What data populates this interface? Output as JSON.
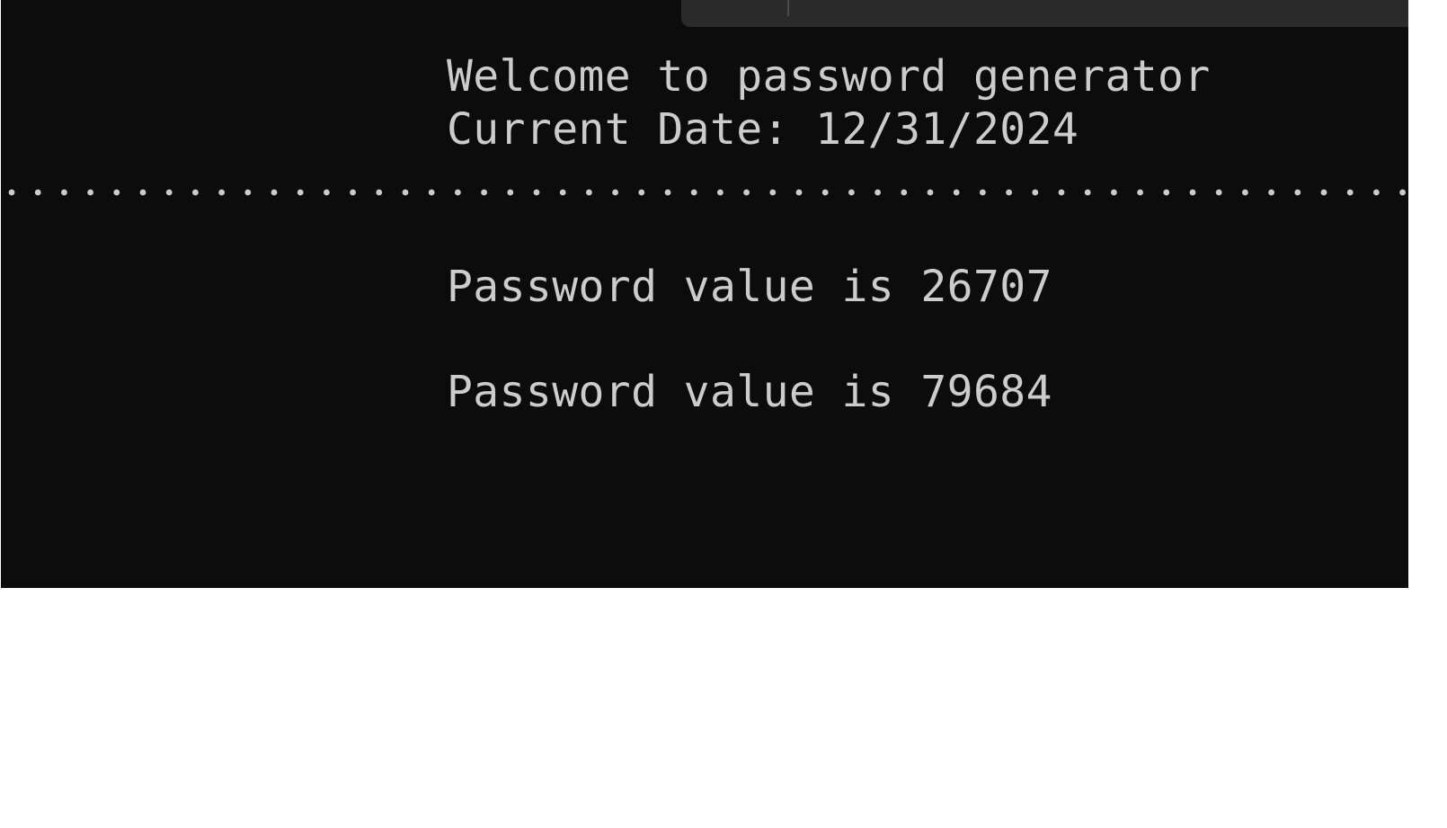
{
  "console": {
    "lines": {
      "welcome": "Welcome to password generator",
      "date": "Current Date: 12/31/2024",
      "password_1": "Password value is 26707",
      "password_2": "Password value is 79684"
    },
    "colors": {
      "background": "#0c0c0c",
      "text": "#cccccc",
      "tab_bar": "#2b2b2b",
      "page": "#ffffff"
    }
  }
}
